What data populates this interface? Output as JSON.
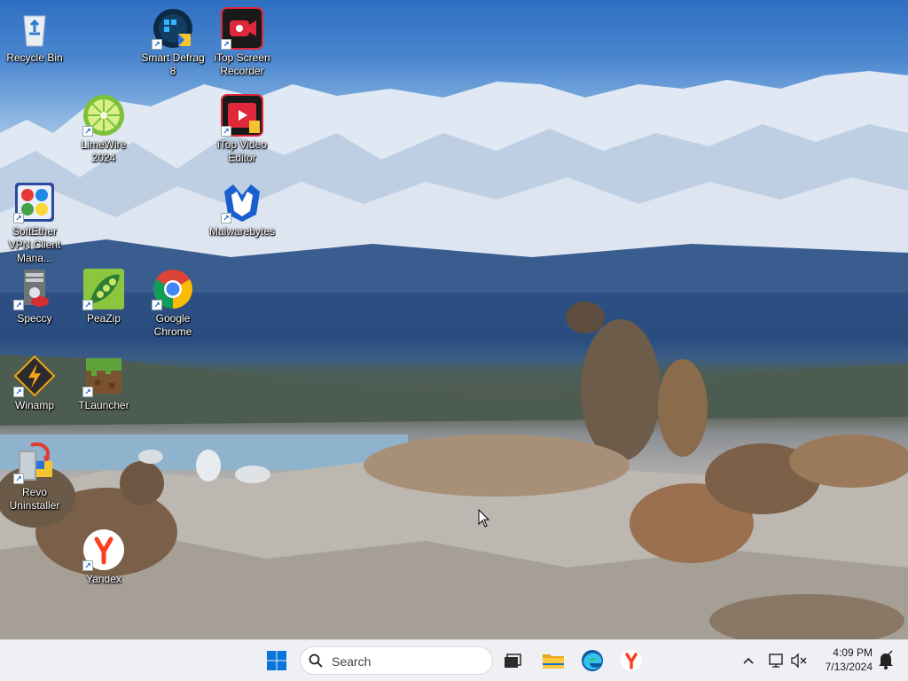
{
  "desktop": {
    "icons": [
      {
        "label": "Recycle Bin",
        "icon": "recycle-bin-icon"
      },
      {
        "label": "Smart Defrag 8",
        "icon": "smart-defrag-icon"
      },
      {
        "label": "iTop Screen Recorder",
        "icon": "itop-screen-recorder-icon"
      },
      {
        "label": "LimeWire 2024",
        "icon": "limewire-icon"
      },
      {
        "label": "iTop Video Editor",
        "icon": "itop-video-editor-icon"
      },
      {
        "label": "SoftEther VPN Client Mana...",
        "icon": "softether-vpn-icon"
      },
      {
        "label": "Malwarebytes",
        "icon": "malwarebytes-icon"
      },
      {
        "label": "Speccy",
        "icon": "speccy-icon"
      },
      {
        "label": "PeaZip",
        "icon": "peazip-icon"
      },
      {
        "label": "Google Chrome",
        "icon": "google-chrome-icon"
      },
      {
        "label": "Winamp",
        "icon": "winamp-icon"
      },
      {
        "label": "TLauncher",
        "icon": "tlauncher-icon"
      },
      {
        "label": "Revo Uninstaller",
        "icon": "revo-uninstaller-icon"
      },
      {
        "label": "Yandex",
        "icon": "yandex-icon"
      }
    ]
  },
  "taskbar": {
    "search_placeholder": "Search",
    "pinned": [
      "windows-start-icon",
      "task-view-icon",
      "file-explorer-icon",
      "edge-icon",
      "yandex-browser-icon"
    ],
    "tray": {
      "time": "4:09 PM",
      "date": "7/13/2024",
      "icons": [
        "chevron-up-icon",
        "network-icon",
        "volume-muted-icon",
        "notification-bell-icon"
      ]
    }
  },
  "colors": {
    "taskbar_bg": "#eef0f3",
    "accent": "#0067c0"
  }
}
